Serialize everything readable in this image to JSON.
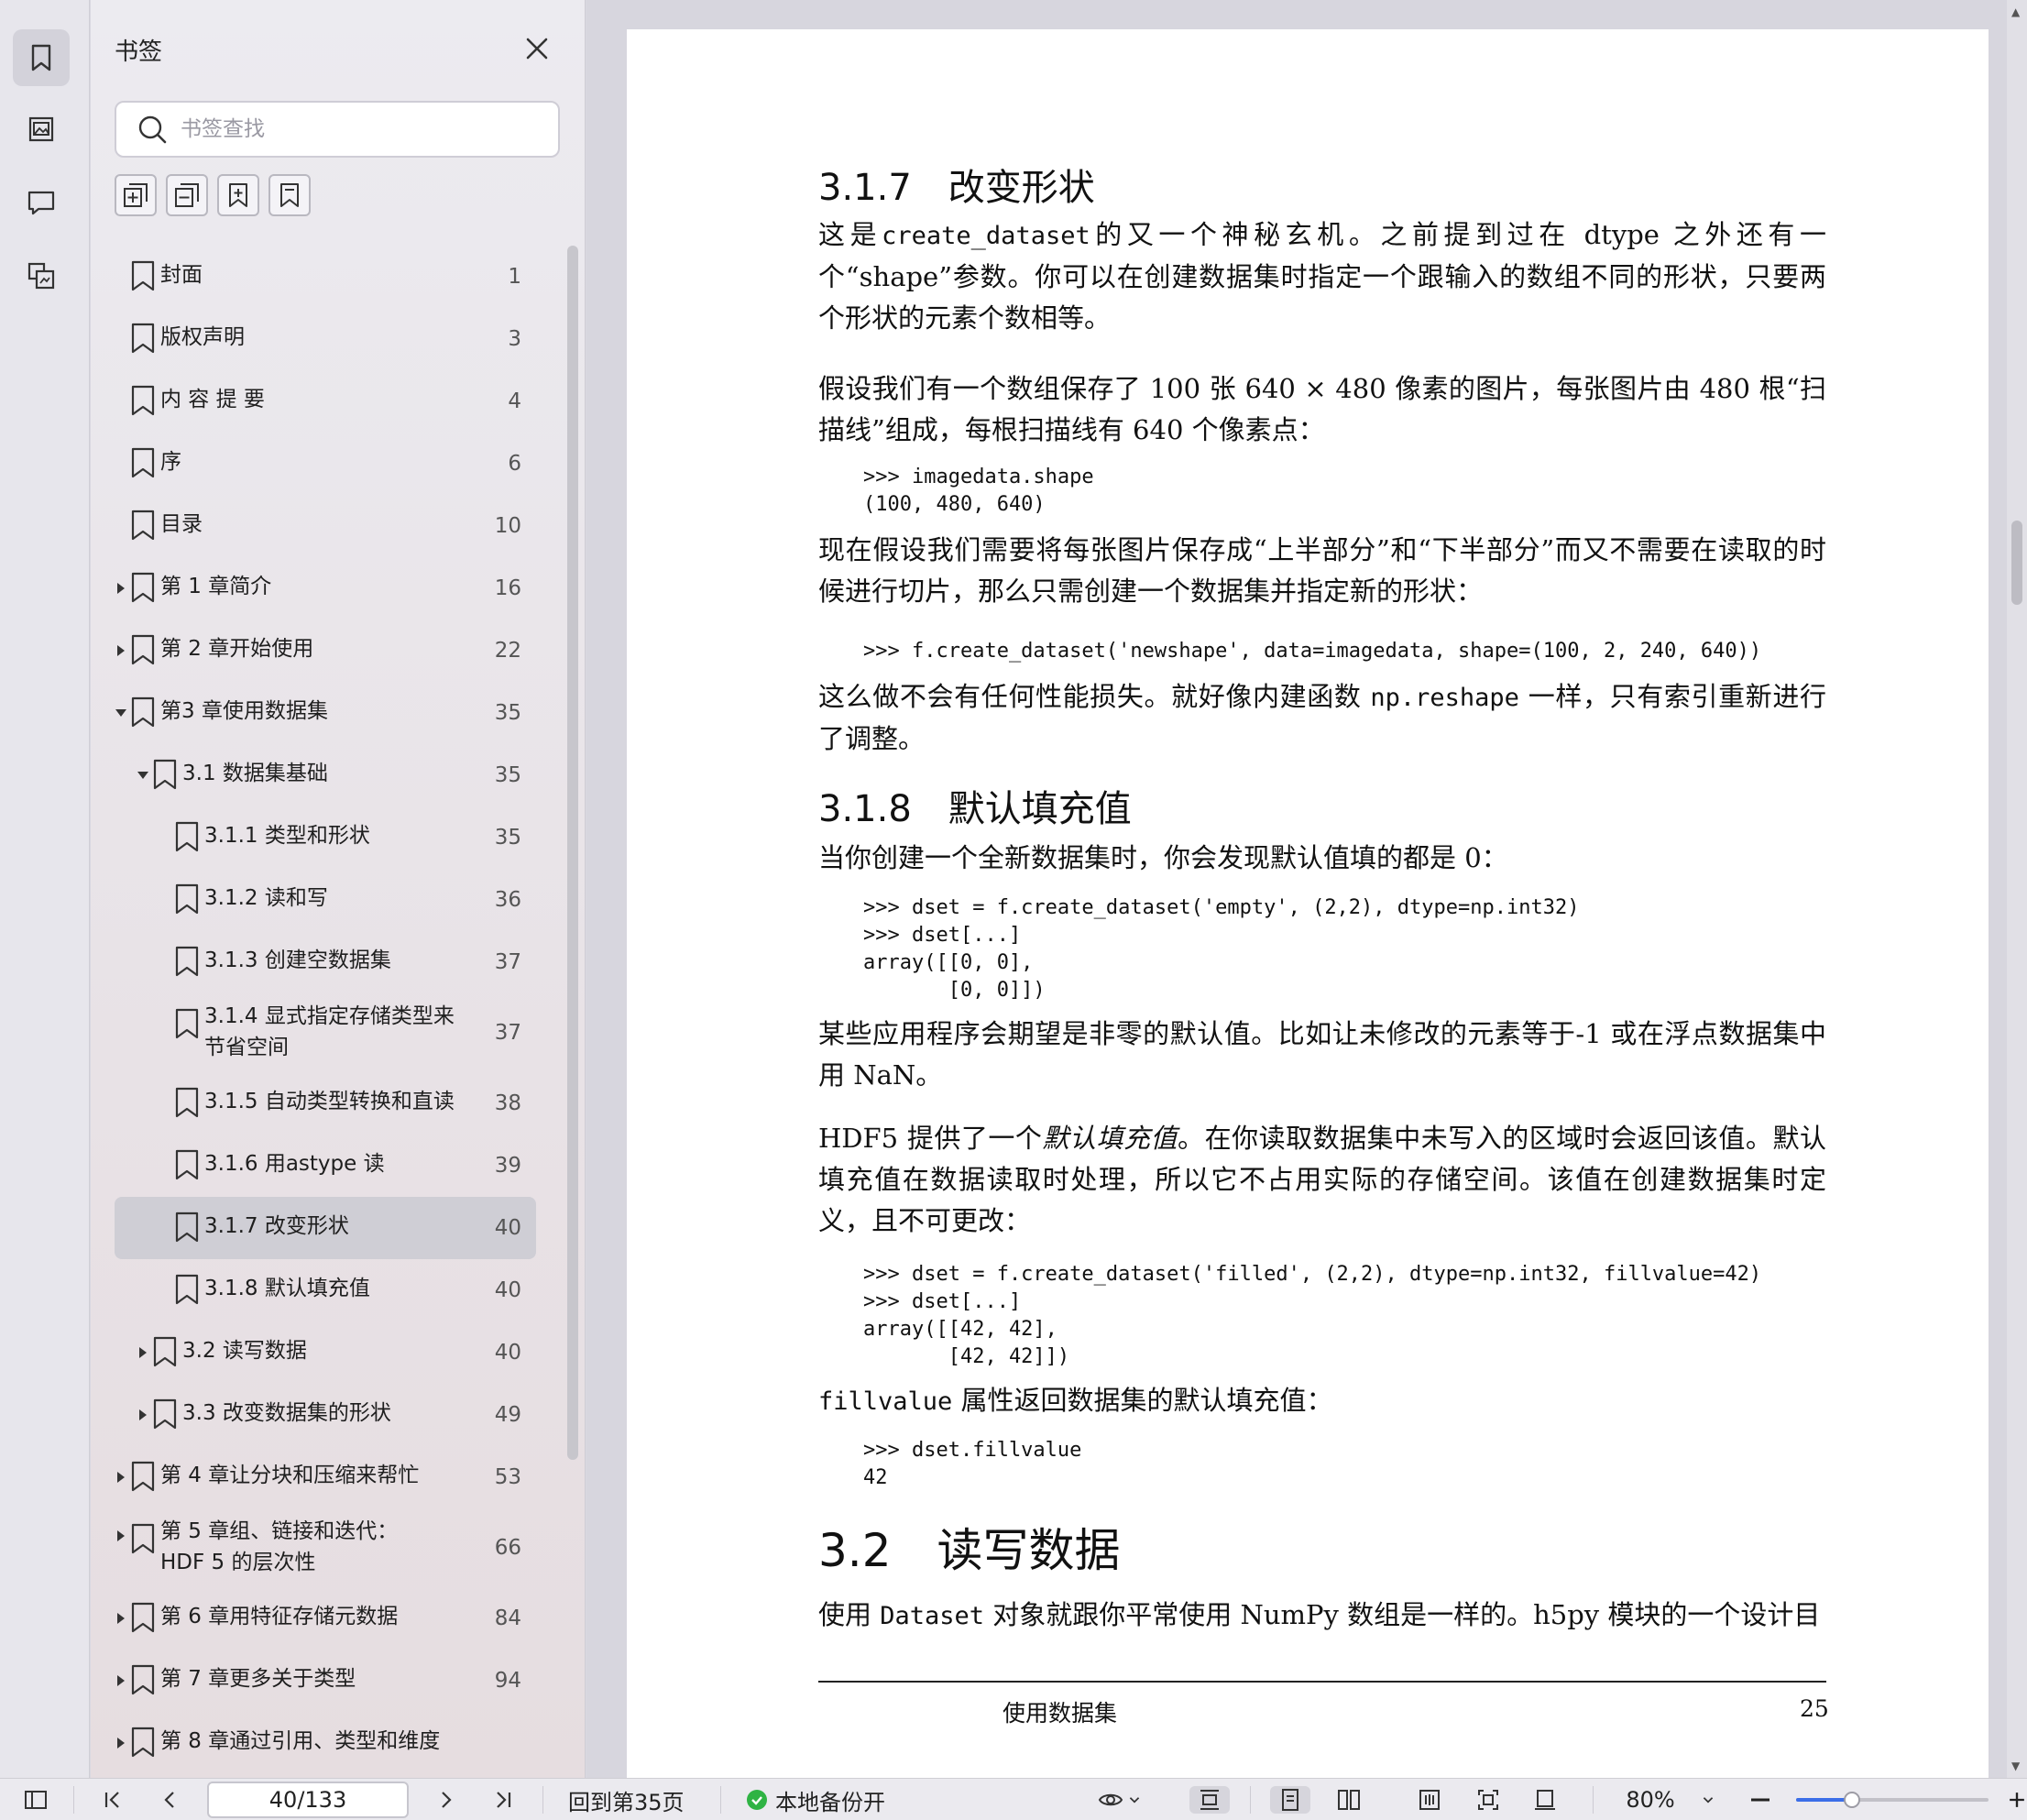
{
  "sidebar": {
    "title": "书签",
    "search_placeholder": "书签查找",
    "items": [
      {
        "label": "封面",
        "page": "1",
        "level": 0,
        "expander": "none"
      },
      {
        "label": "版权声明",
        "page": "3",
        "level": 0,
        "expander": "none"
      },
      {
        "label": "内 容 提 要",
        "page": "4",
        "level": 0,
        "expander": "none"
      },
      {
        "label": "序",
        "page": "6",
        "level": 0,
        "expander": "none"
      },
      {
        "label": "目录",
        "page": "10",
        "level": 0,
        "expander": "none"
      },
      {
        "label": "第 1 章简介",
        "page": "16",
        "level": 0,
        "expander": "collapsed"
      },
      {
        "label": "第 2 章开始使用",
        "page": "22",
        "level": 0,
        "expander": "collapsed"
      },
      {
        "label": "第3 章使用数据集",
        "page": "35",
        "level": 0,
        "expander": "expanded"
      },
      {
        "label": "3.1 数据集基础",
        "page": "35",
        "level": 1,
        "expander": "expanded"
      },
      {
        "label": "3.1.1 类型和形状",
        "page": "35",
        "level": 2,
        "expander": "none"
      },
      {
        "label": "3.1.2 读和写",
        "page": "36",
        "level": 2,
        "expander": "none"
      },
      {
        "label": "3.1.3 创建空数据集",
        "page": "37",
        "level": 2,
        "expander": "none"
      },
      {
        "label": "3.1.4 显式指定存储类型来节省空间",
        "page": "37",
        "level": 2,
        "expander": "none",
        "wrap": true
      },
      {
        "label": "3.1.5 自动类型转换和直读",
        "page": "38",
        "level": 2,
        "expander": "none"
      },
      {
        "label": "3.1.6 用astype 读",
        "page": "39",
        "level": 2,
        "expander": "none"
      },
      {
        "label": "3.1.7 改变形状",
        "page": "40",
        "level": 2,
        "expander": "none",
        "selected": true
      },
      {
        "label": "3.1.8 默认填充值",
        "page": "40",
        "level": 2,
        "expander": "none"
      },
      {
        "label": "3.2 读写数据",
        "page": "40",
        "level": 1,
        "expander": "collapsed"
      },
      {
        "label": "3.3 改变数据集的形状",
        "page": "49",
        "level": 1,
        "expander": "collapsed"
      },
      {
        "label": "第 4 章让分块和压缩来帮忙",
        "page": "53",
        "level": 0,
        "expander": "collapsed"
      },
      {
        "label": "第 5 章组、链接和迭代：HDF 5 的层次性",
        "page": "66",
        "level": 0,
        "expander": "collapsed",
        "wrap": true
      },
      {
        "label": "第 6 章用特征存储元数据",
        "page": "84",
        "level": 0,
        "expander": "collapsed"
      },
      {
        "label": "第 7 章更多关于类型",
        "page": "94",
        "level": 0,
        "expander": "collapsed"
      },
      {
        "label": "第 8 章通过引用、类型和维度",
        "page": "",
        "level": 0,
        "expander": "collapsed"
      }
    ]
  },
  "document": {
    "h_317": "3.1.7　改变形状",
    "p1_a": "这是",
    "p1_code": "create_dataset",
    "p1_b": "的又一个神秘玄机。之前提到过在 dtype 之外还有一个“shape”参数。你可以在创建数据集时指定一个跟输入的数组不同的形状，只要两个形状的元素个数相等。",
    "p2": "假设我们有一个数组保存了 100 张 640 × 480 像素的图片，每张图片由 480 根“扫描线”组成，每根扫描线有 640 个像素点：",
    "code1": ">>> imagedata.shape\n(100, 480, 640)",
    "p3": "现在假设我们需要将每张图片保存成“上半部分”和“下半部分”而又不需要在读取的时候进行切片，那么只需创建一个数据集并指定新的形状：",
    "code2": ">>> f.create_dataset('newshape', data=imagedata, shape=(100, 2, 240, 640))",
    "p4_a": "这么做不会有任何性能损失。就好像内建函数 ",
    "p4_code": "np.reshape",
    "p4_b": " 一样，只有索引重新进行了调整。",
    "h_318": "3.1.8　默认填充值",
    "p5": "当你创建一个全新数据集时，你会发现默认值填的都是 0：",
    "code3": ">>> dset = f.create_dataset('empty', (2,2), dtype=np.int32)\n>>> dset[...]\narray([[0, 0],\n       [0, 0]])",
    "p6": "某些应用程序会期望是非零的默认值。比如让未修改的元素等于-1 或在浮点数据集中用 NaN。",
    "p7_a": "HDF5 提供了一个",
    "p7_em": "默认填充值",
    "p7_b": "。在你读取数据集中未写入的区域时会返回该值。默认填充值在数据读取时处理，所以它不占用实际的存储空间。该值在创建数据集时定义，且不可更改：",
    "code4": ">>> dset = f.create_dataset('filled', (2,2), dtype=np.int32, fillvalue=42)\n>>> dset[...]\narray([[42, 42],\n       [42, 42]])",
    "p8_code": "fillvalue",
    "p8_b": " 属性返回数据集的默认填充值：",
    "code5": ">>> dset.fillvalue\n42",
    "h_32": "3.2　读写数据",
    "p9_a": "使用 ",
    "p9_code": "Dataset",
    "p9_b": " 对象就跟你平常使用 NumPy 数组是一样的。h5py 模块的一个设计目",
    "footer_title": "使用数据集",
    "footer_page": "25"
  },
  "statusbar": {
    "page_value": "40/133",
    "back_to_page": "回到第35页",
    "backup_label": "本地备份开",
    "zoom_label": "80%",
    "zoom_fraction": 0.29,
    "backup_color": "#2fb344",
    "accent": "#3b6ee8"
  }
}
